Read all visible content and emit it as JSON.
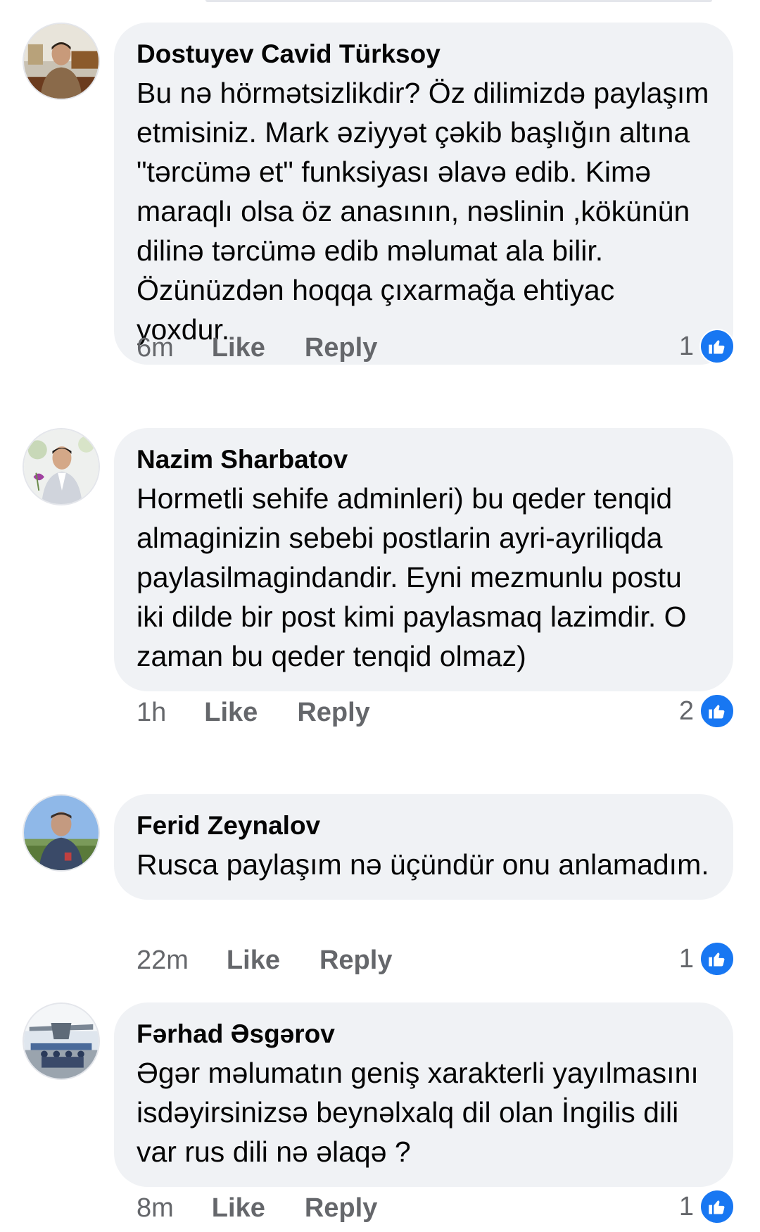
{
  "comments": [
    {
      "author": "Dostuyev Cavid Türksoy",
      "text": "Bu nə hörmətsizlikdir? Öz dilimizdə paylaşım etmisiniz. Mark əziyyət çəkib başlığın altına \"tərcümə et\" funksiyası əlavə edib. Kimə maraqlı olsa öz anasının, nəslinin ,kökünün dilinə tərcümə edib məlumat ala bilir. Özünüzdən hoqqa çıxarmağa ehtiyac yoxdur.",
      "time": "6m",
      "like_label": "Like",
      "reply_label": "Reply",
      "reaction_count": "1"
    },
    {
      "author": "Nazim Sharbatov",
      "text": "Hormetli sehife adminleri) bu qeder tenqid almaginizin sebebi postlarin ayri-ayriliqda paylasilmagindandir. Eyni mezmunlu postu iki dilde bir post kimi paylasmaq lazimdir. O zaman bu qeder tenqid olmaz)",
      "time": "1h",
      "like_label": "Like",
      "reply_label": "Reply",
      "reaction_count": "2"
    },
    {
      "author": "Ferid Zeynalov",
      "text": "Rusca paylaşım nə üçündür onu anlamadım.",
      "time": "22m",
      "like_label": "Like",
      "reply_label": "Reply",
      "reaction_count": "1"
    },
    {
      "author": "Fərhad Əsgərov",
      "text": "Əgər məlumatın geniş xarakterli yayılmasını isdəyirsinizsə beynəlxalq dil olan İngilis dili var rus dili nə əlaqə ?",
      "time": "8m",
      "like_label": "Like",
      "reply_label": "Reply",
      "reaction_count": "1"
    }
  ],
  "colors": {
    "bubble": "#f0f2f5",
    "meta_text": "#65676b",
    "like_blue": "#1877f2"
  },
  "icons": {
    "reaction": "thumbs-up-icon"
  }
}
